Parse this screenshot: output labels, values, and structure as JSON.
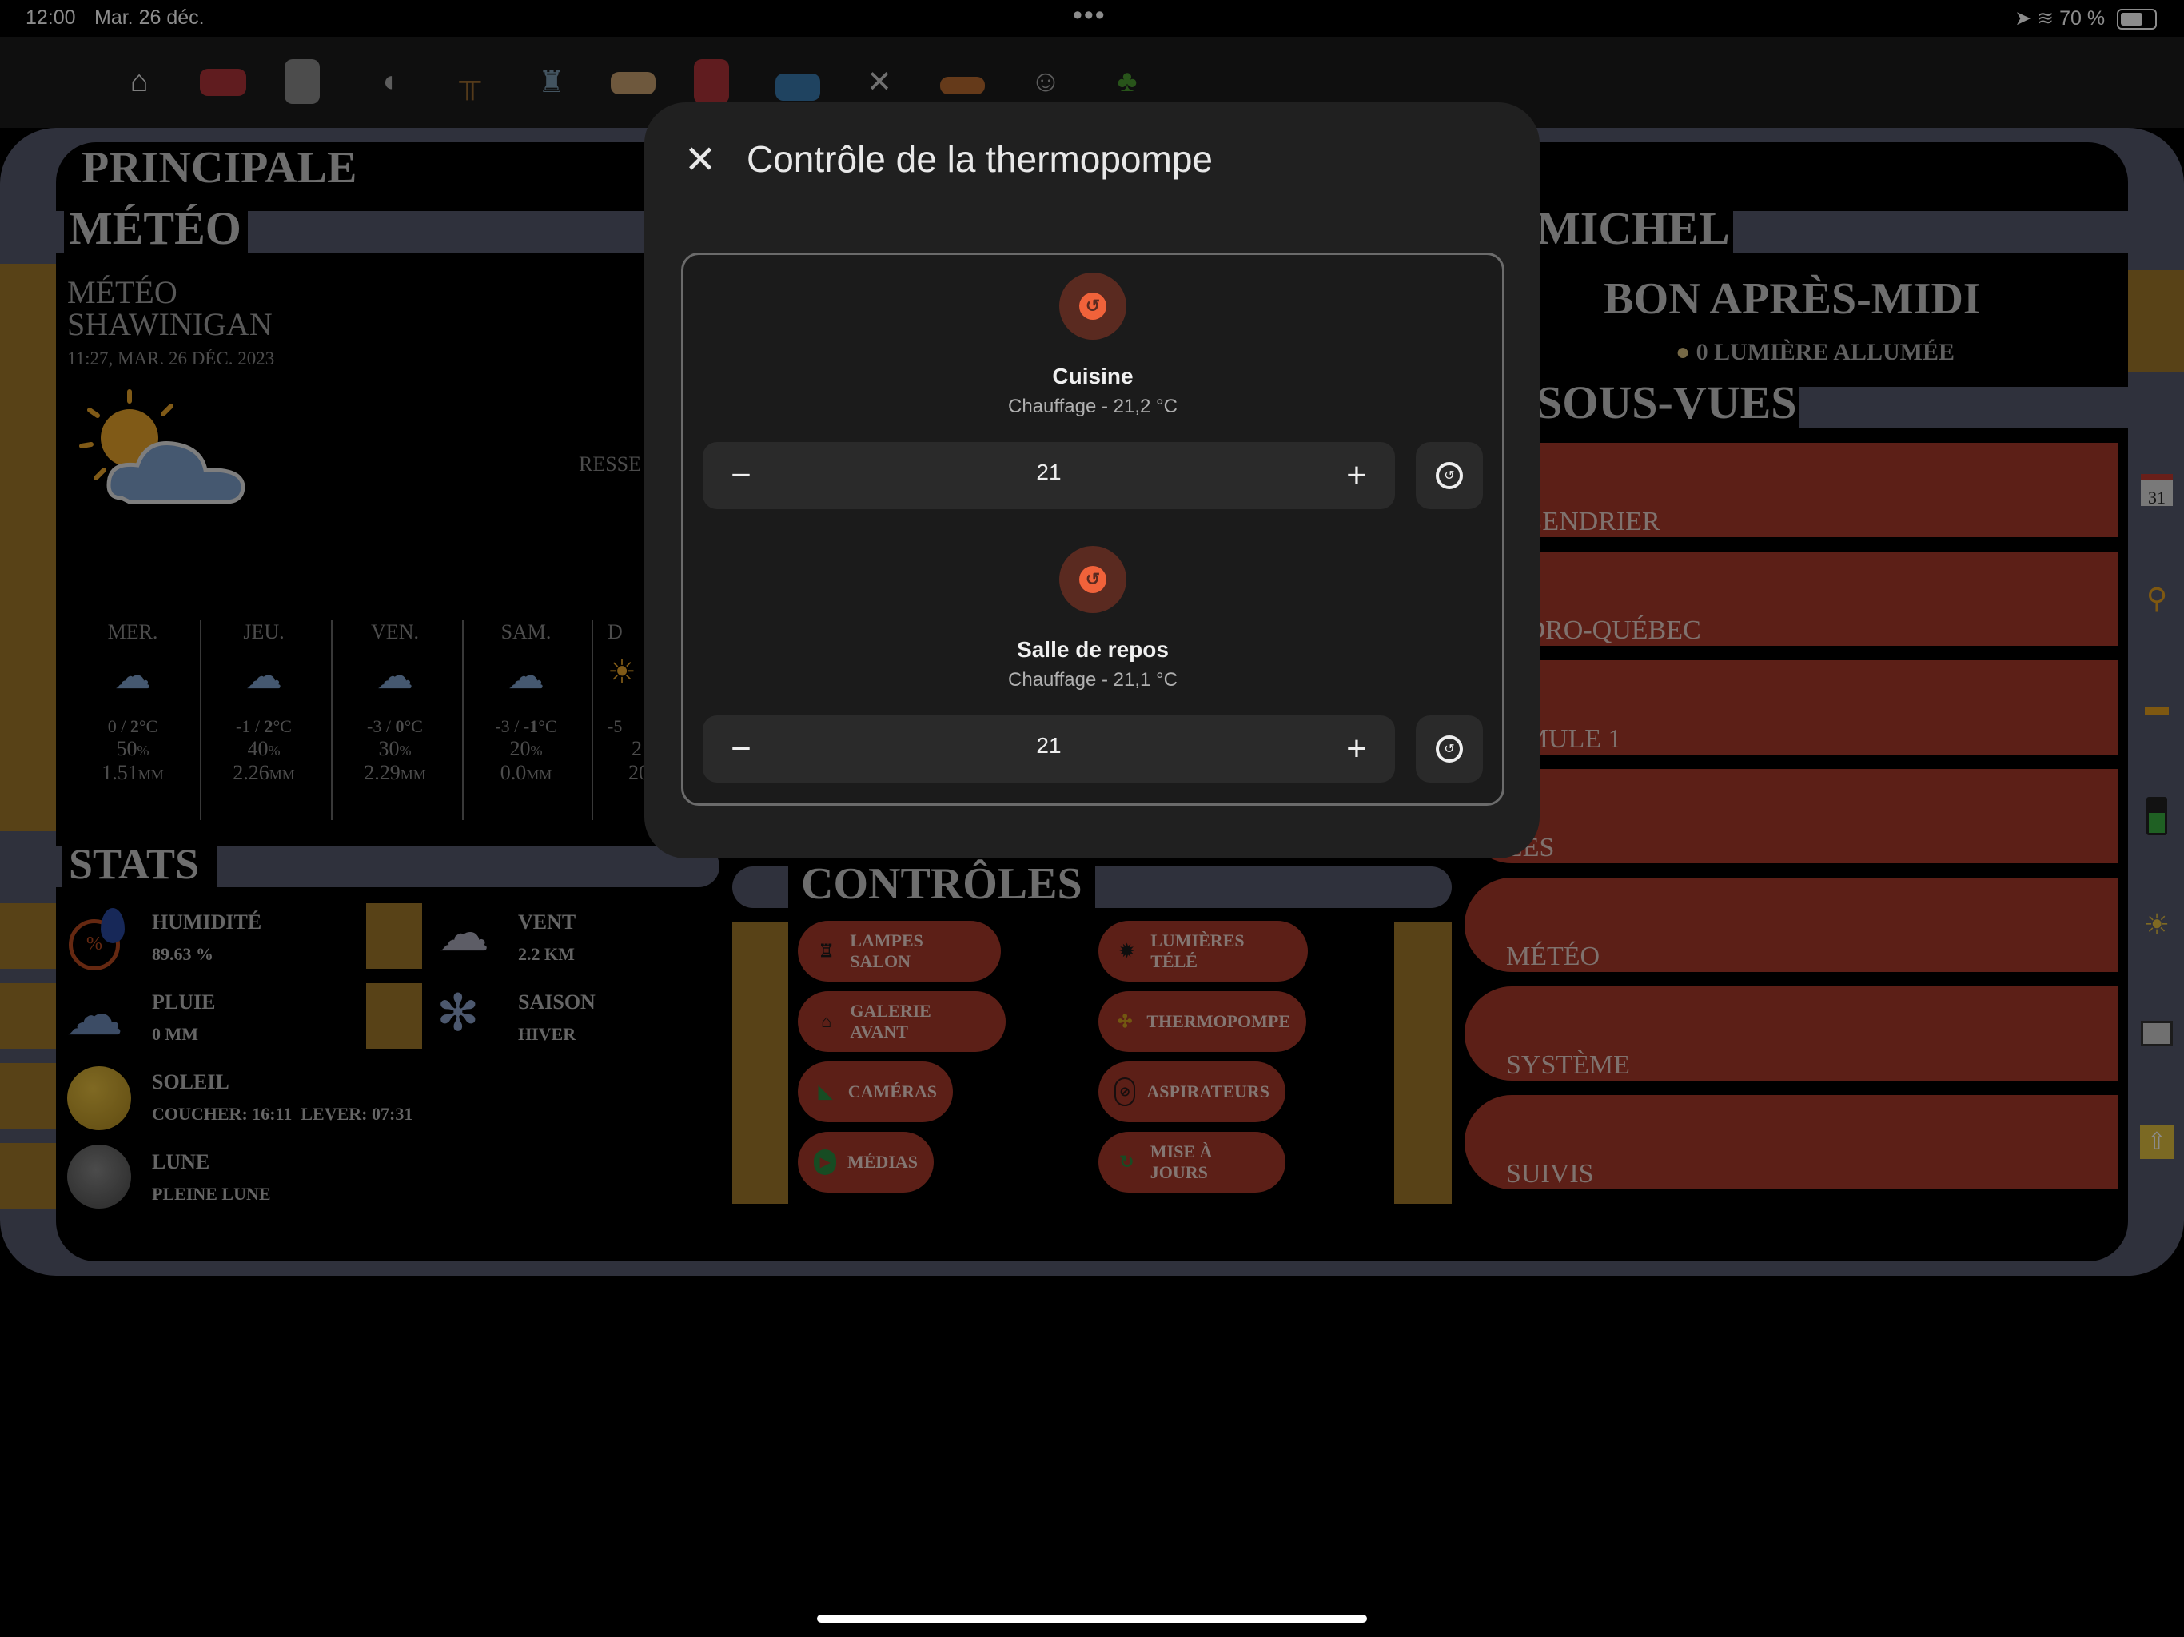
{
  "status_bar": {
    "time": "12:00",
    "date": "Mar. 26 déc.",
    "dots": "•••",
    "battery": "70 %"
  },
  "nav": {
    "icons": [
      "home-icon",
      "sofa-icon",
      "stove-icon",
      "toilet-icon",
      "table-icon",
      "office-icon",
      "bed-icon",
      "armchair-icon",
      "pool-icon",
      "tools-icon",
      "basement-icon",
      "family-icon",
      "tree-icon"
    ]
  },
  "page": {
    "title": "PRINCIPALE"
  },
  "meteo": {
    "section": "MÉTÉO",
    "heading_line1": "MÉTÉO",
    "heading_line2": "SHAWINIGAN",
    "datetime": "11:27, MAR. 26 DÉC. 2023",
    "ressenti_label": "RESSE",
    "forecast": [
      {
        "day": "MER.",
        "lo": "0",
        "hi": "2",
        "unit": "°C",
        "pop": "50",
        "pct": "%",
        "precip": "1.51",
        "mm": "MM"
      },
      {
        "day": "JEU.",
        "lo": "-1",
        "hi": "2",
        "unit": "°C",
        "pop": "40",
        "pct": "%",
        "precip": "2.26",
        "mm": "MM"
      },
      {
        "day": "VEN.",
        "lo": "-3",
        "hi": "0",
        "unit": "°C",
        "pop": "30",
        "pct": "%",
        "precip": "2.29",
        "mm": "MM"
      },
      {
        "day": "SAM.",
        "lo": "-3",
        "hi": "-1",
        "unit": "°C",
        "pop": "20",
        "pct": "%",
        "precip": "0.0",
        "mm": "MM"
      },
      {
        "day": "D",
        "lo": "-5",
        "pop": "2",
        "precip": "20"
      }
    ]
  },
  "stats": {
    "section": "STATS",
    "humidite": {
      "label": "HUMIDITÉ",
      "value": "89.63 %"
    },
    "vent": {
      "label": "VENT",
      "value": "2.2 KM"
    },
    "pluie": {
      "label": "PLUIE",
      "value": "0 MM"
    },
    "saison": {
      "label": "SAISON",
      "value": "HIVER"
    },
    "soleil": {
      "label": "SOLEIL",
      "value": "COUCHER: 16:11  LEVER: 07:31"
    },
    "lune": {
      "label": "LUNE",
      "value": "PLEINE LUNE"
    }
  },
  "controles": {
    "section": "CONTRÔLES",
    "buttons": [
      {
        "label": "LAMPES SALON"
      },
      {
        "label": "LUMIÈRES TÉLÉ"
      },
      {
        "label": "GALERIE AVANT"
      },
      {
        "label": "THERMOPOMPE"
      },
      {
        "label": "CAMÉRAS"
      },
      {
        "label": "ASPIRATEURS"
      },
      {
        "label": "MÉDIAS"
      },
      {
        "label": "MISE À JOURS"
      }
    ]
  },
  "michel": {
    "section": "MICHEL",
    "greeting": "BON APRÈS-MIDI",
    "lights": "0 LUMIÈRE ALLUMÉE"
  },
  "sous_vues": {
    "section": "SOUS-VUES",
    "items": [
      {
        "label": "ALENDRIER",
        "icon": "calendar-icon",
        "icon_text": "31"
      },
      {
        "label": "YDRO-QUÉBEC",
        "icon": "search-icon"
      },
      {
        "label": "RMULE 1",
        "icon": "race-car-icon"
      },
      {
        "label": "LES",
        "icon": "battery-icon"
      },
      {
        "label": "MÉTÉO",
        "icon": "weather-icon"
      },
      {
        "label": "SYSTÈME",
        "icon": "computer-icon"
      },
      {
        "label": "SUIVIS",
        "icon": "upload-icon"
      }
    ]
  },
  "modal": {
    "title": "Contrôle de la thermopompe",
    "zones": [
      {
        "name": "Cuisine",
        "state": "Chauffage - 21,2 °C",
        "setpoint": "21"
      },
      {
        "name": "Salle de repos",
        "state": "Chauffage - 21,1 °C",
        "setpoint": "21"
      }
    ]
  },
  "colors": {
    "accent_red": "#a8392a",
    "frame": "#575a6e",
    "gold": "#a0782b",
    "heat": "#f0623a"
  }
}
